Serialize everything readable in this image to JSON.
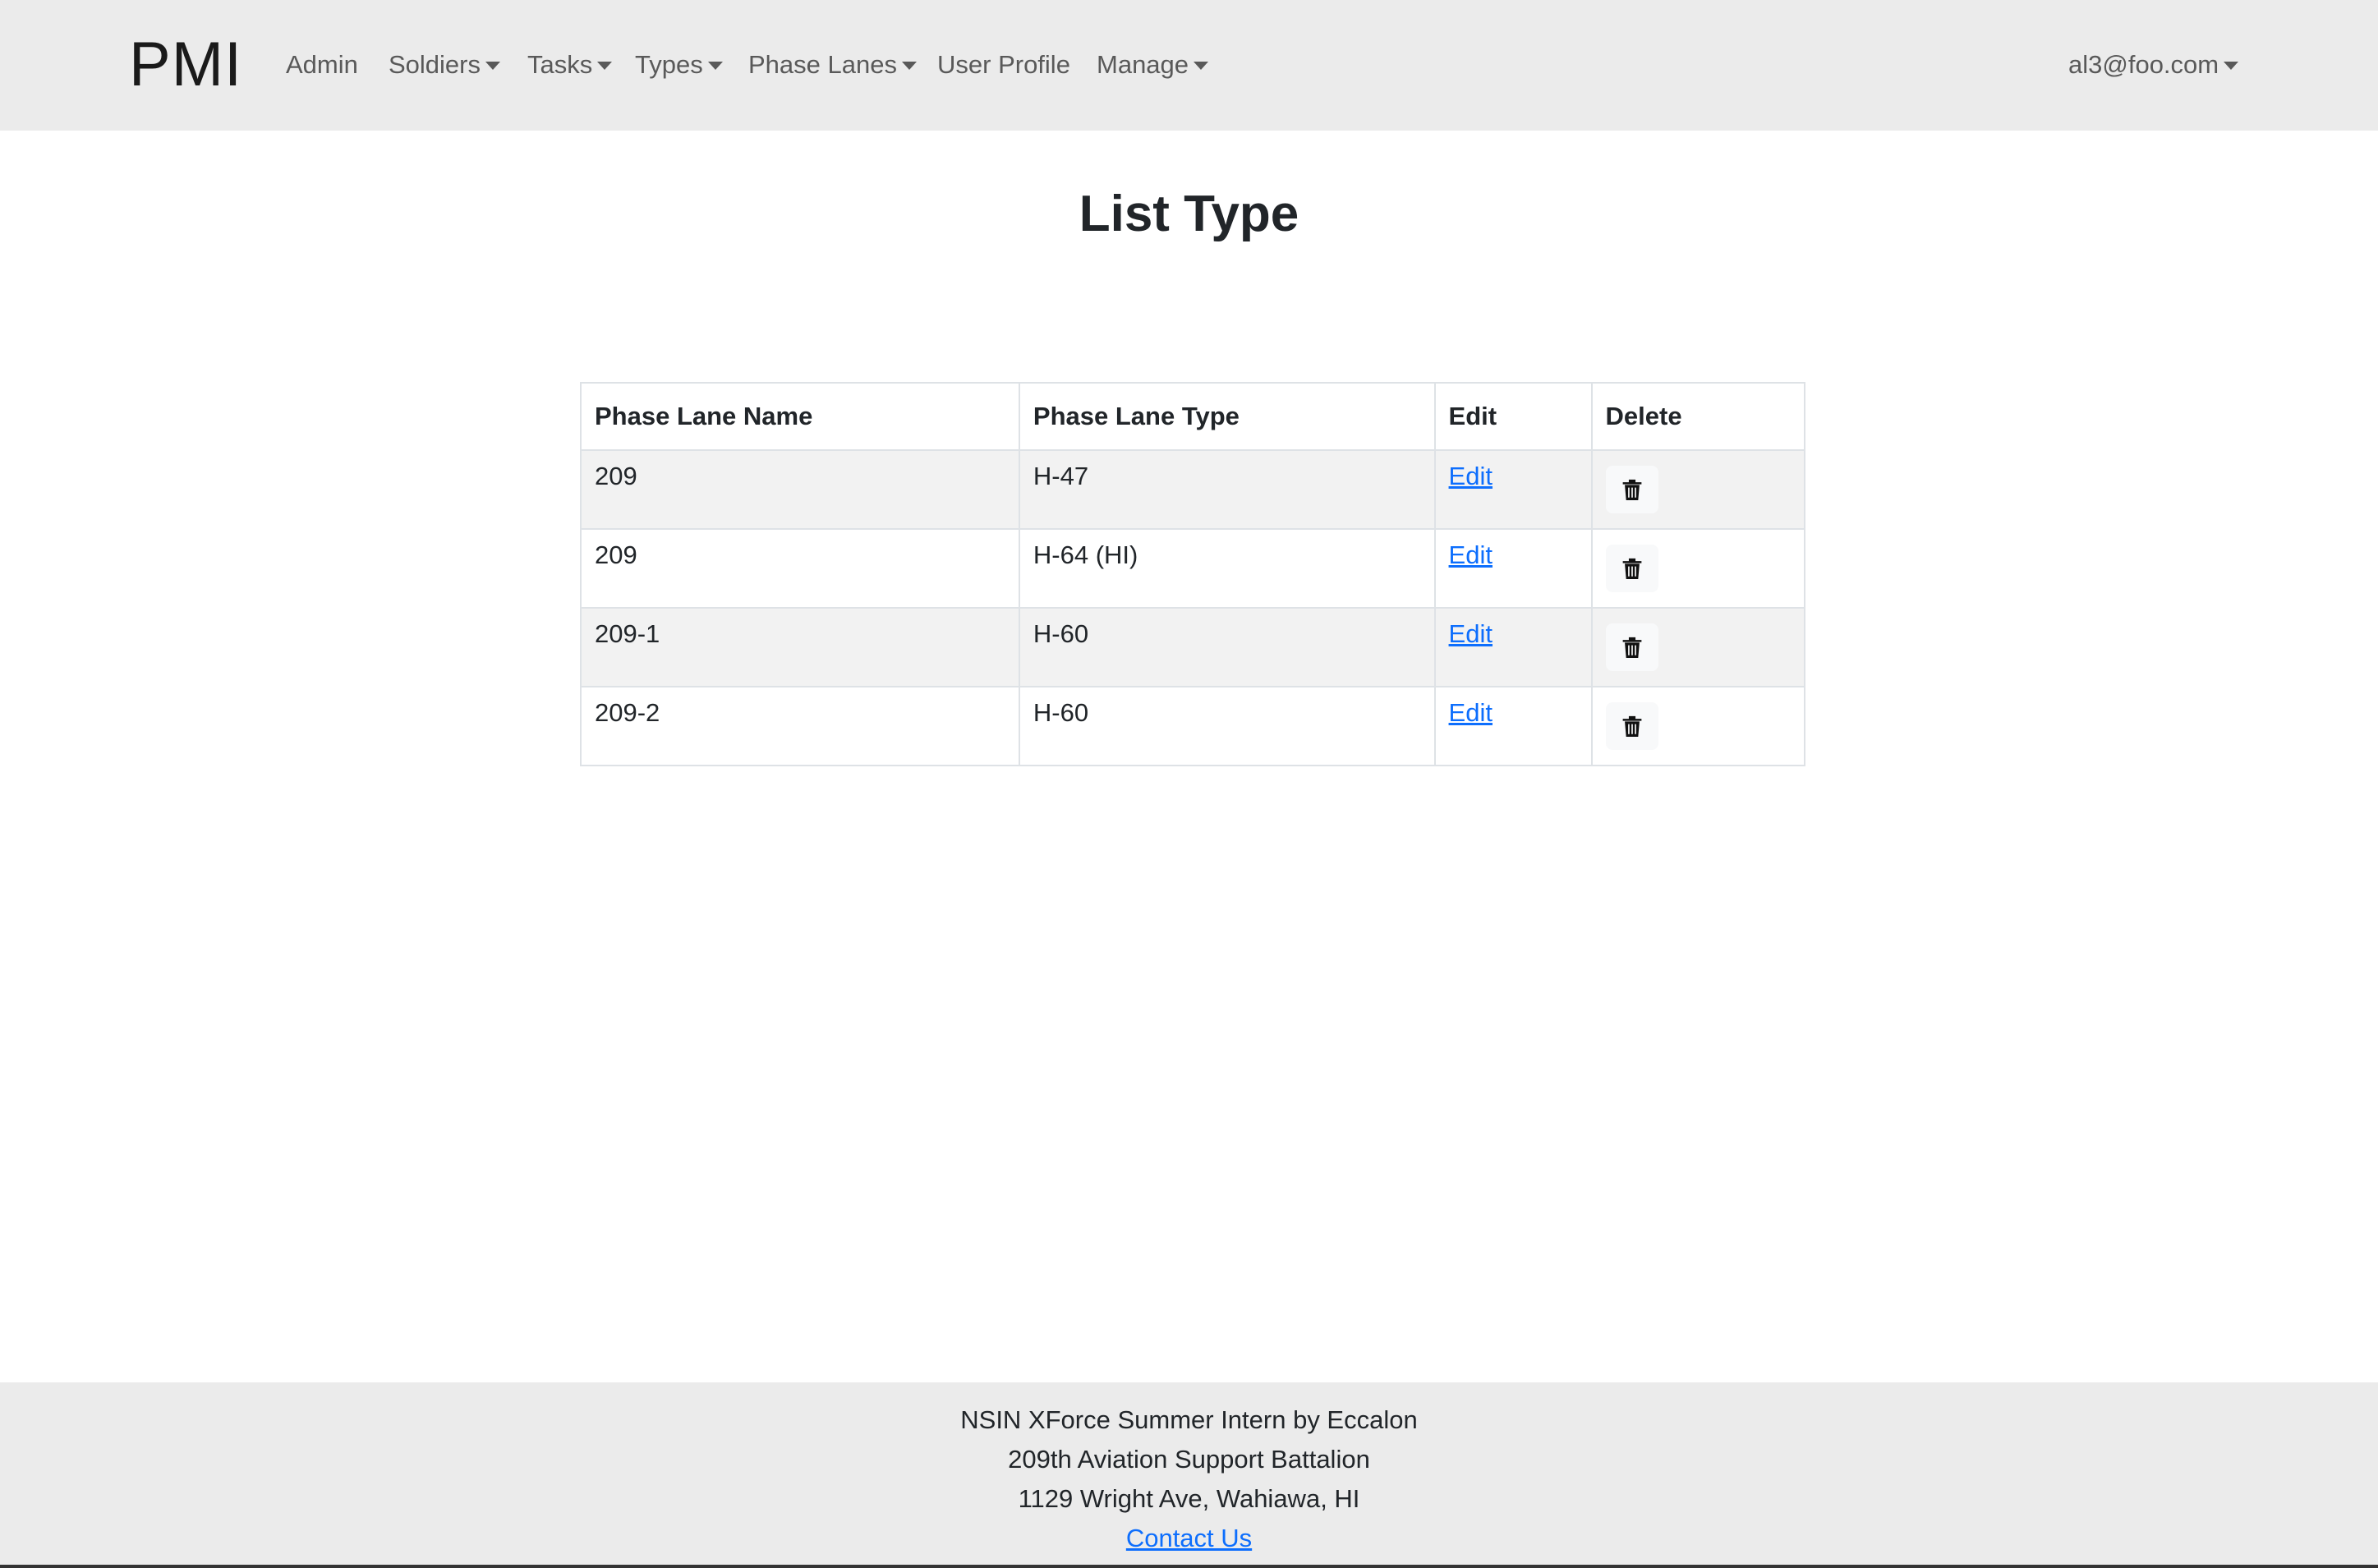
{
  "navbar": {
    "brand": "PMI",
    "items": [
      {
        "label": "Admin",
        "dropdown": false
      },
      {
        "label": "Soldiers",
        "dropdown": true
      },
      {
        "label": "Tasks",
        "dropdown": true
      },
      {
        "label": "Types",
        "dropdown": true
      },
      {
        "label": "Phase Lanes",
        "dropdown": true
      },
      {
        "label": "User Profile",
        "dropdown": false
      },
      {
        "label": "Manage",
        "dropdown": true
      }
    ],
    "user": "al3@foo.com"
  },
  "page": {
    "title": "List Type"
  },
  "table": {
    "headers": [
      "Phase Lane Name",
      "Phase Lane Type",
      "Edit",
      "Delete"
    ],
    "rows": [
      {
        "name": "209",
        "type": "H-47",
        "edit": "Edit"
      },
      {
        "name": "209",
        "type": "H-64 (HI)",
        "edit": "Edit"
      },
      {
        "name": "209-1",
        "type": "H-60",
        "edit": "Edit"
      },
      {
        "name": "209-2",
        "type": "H-60",
        "edit": "Edit"
      }
    ],
    "delete_icon": "trash-icon"
  },
  "footer": {
    "line1": "NSIN XForce Summer Intern by Eccalon",
    "line2": "209th Aviation Support Battalion",
    "line3": "1129 Wright Ave, Wahiawa, HI",
    "contact": "Contact Us"
  },
  "colors": {
    "navbar_bg": "#ebebeb",
    "link": "#0d6efd",
    "stripe": "#f2f2f2"
  }
}
